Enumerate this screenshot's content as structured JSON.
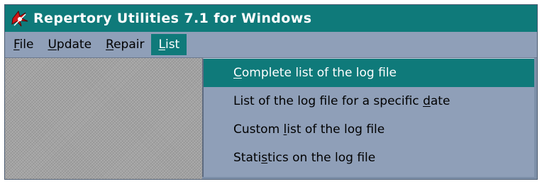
{
  "window": {
    "title": "Repertory Utilities 7.1 for Windows",
    "app_icon": "app-logo-icon"
  },
  "menubar": {
    "items": [
      {
        "pre": "",
        "key": "F",
        "post": "ile"
      },
      {
        "pre": "",
        "key": "U",
        "post": "pdate"
      },
      {
        "pre": "",
        "key": "R",
        "post": "epair"
      },
      {
        "pre": "",
        "key": "L",
        "post": "ist"
      }
    ],
    "active_index": 3
  },
  "dropdown": {
    "items": [
      {
        "pre": "",
        "key": "C",
        "post": "omplete list of the log file"
      },
      {
        "pre": "List of the log file for a specific ",
        "key": "d",
        "post": "ate"
      },
      {
        "pre": "Custom ",
        "key": "l",
        "post": "ist of the log file"
      },
      {
        "pre": "Stati",
        "key": "s",
        "post": "tics on the log file"
      }
    ],
    "highlighted_index": 0
  },
  "colors": {
    "title_bar": "#0f7a7a",
    "menu_bg": "#8f9fb8",
    "highlight": "#0f7a7a",
    "workspace": "#a3a3a3"
  }
}
